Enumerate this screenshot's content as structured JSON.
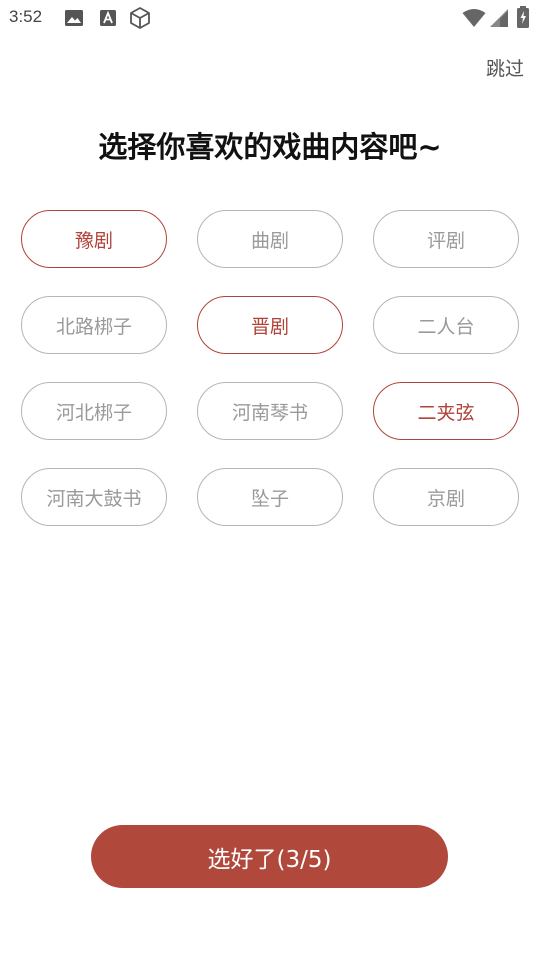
{
  "status_bar": {
    "time": "3:52",
    "icons": [
      "image-icon",
      "a-notification-icon",
      "cube-icon",
      "wifi-icon",
      "signal-icon",
      "battery-icon"
    ]
  },
  "header": {
    "skip_label": "跳过"
  },
  "title": "选择你喜欢的戏曲内容吧~",
  "options": [
    {
      "label": "豫剧",
      "selected": true
    },
    {
      "label": "曲剧",
      "selected": false
    },
    {
      "label": "评剧",
      "selected": false
    },
    {
      "label": "北路梆子",
      "selected": false
    },
    {
      "label": "晋剧",
      "selected": true
    },
    {
      "label": "二人台",
      "selected": false
    },
    {
      "label": "河北梆子",
      "selected": false
    },
    {
      "label": "河南琴书",
      "selected": false
    },
    {
      "label": "二夹弦",
      "selected": true
    },
    {
      "label": "河南大鼓书",
      "selected": false
    },
    {
      "label": "坠子",
      "selected": false
    },
    {
      "label": "京剧",
      "selected": false
    }
  ],
  "confirm_label": "选好了(3/5)",
  "colors": {
    "accent": "#b0493c",
    "selected_text": "#b04339",
    "unselected_text": "#9a9a9a",
    "unselected_border": "#b5b5b5"
  }
}
